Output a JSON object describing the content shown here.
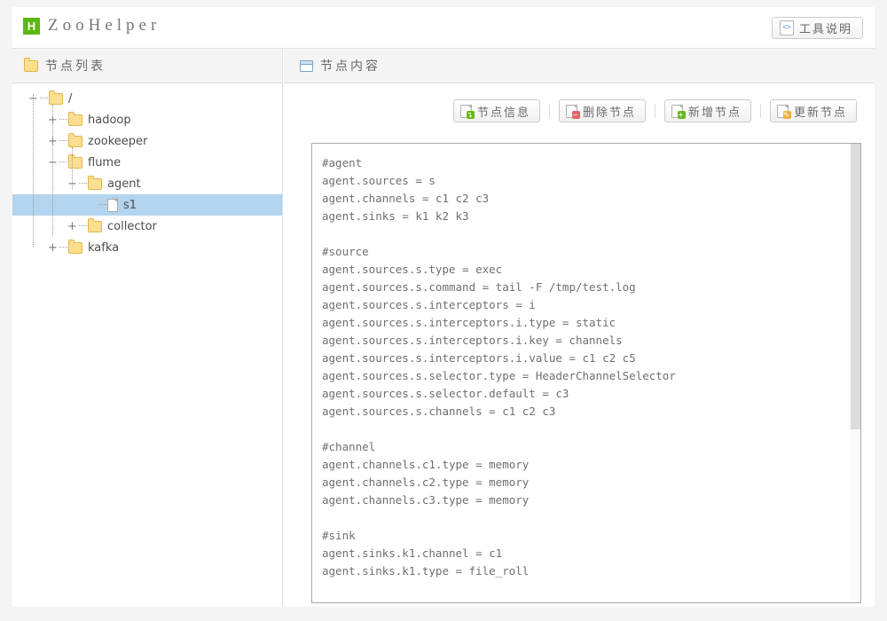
{
  "header": {
    "logo_letter": "H",
    "logo_color": "#5cb811",
    "brand": "ZooHelper",
    "help_button": "工具说明",
    "help_icon": "code-file-icon"
  },
  "left_panel": {
    "title": "节点列表",
    "title_icon": "folder-icon",
    "tree": [
      {
        "label": "/",
        "depth": 0,
        "toggle": "minus",
        "icon": "folder-open-icon",
        "selected": false
      },
      {
        "label": "hadoop",
        "depth": 1,
        "toggle": "plus",
        "icon": "folder-icon",
        "selected": false
      },
      {
        "label": "zookeeper",
        "depth": 1,
        "toggle": "plus",
        "icon": "folder-icon",
        "selected": false
      },
      {
        "label": "flume",
        "depth": 1,
        "toggle": "minus",
        "icon": "folder-open-icon",
        "selected": false
      },
      {
        "label": "agent",
        "depth": 2,
        "toggle": "minus",
        "icon": "folder-open-icon",
        "selected": false
      },
      {
        "label": "s1",
        "depth": 3,
        "toggle": "none",
        "icon": "file-icon",
        "selected": true
      },
      {
        "label": "collector",
        "depth": 2,
        "toggle": "plus",
        "icon": "folder-icon",
        "selected": false
      },
      {
        "label": "kafka",
        "depth": 1,
        "toggle": "plus",
        "icon": "folder-icon",
        "selected": false
      }
    ]
  },
  "right_panel": {
    "title": "节点内容",
    "title_icon": "window-icon",
    "toolbar": [
      {
        "label": "节点信息",
        "icon": "doc-info-icon",
        "badge": "green",
        "badge_glyph": "↴"
      },
      {
        "label": "删除节点",
        "icon": "doc-delete-icon",
        "badge": "red",
        "badge_glyph": "−"
      },
      {
        "label": "新增节点",
        "icon": "doc-add-icon",
        "badge": "green",
        "badge_glyph": "+"
      },
      {
        "label": "更新节点",
        "icon": "doc-edit-icon",
        "badge": "pencil",
        "badge_glyph": "✎"
      }
    ],
    "node_content": "#agent\nagent.sources = s\nagent.channels = c1 c2 c3\nagent.sinks = k1 k2 k3\n\n#source\nagent.sources.s.type = exec\nagent.sources.s.command = tail -F /tmp/test.log\nagent.sources.s.interceptors = i\nagent.sources.s.interceptors.i.type = static\nagent.sources.s.interceptors.i.key = channels\nagent.sources.s.interceptors.i.value = c1 c2 c5\nagent.sources.s.selector.type = HeaderChannelSelector\nagent.sources.s.selector.default = c3\nagent.sources.s.channels = c1 c2 c3\n\n#channel\nagent.channels.c1.type = memory\nagent.channels.c2.type = memory\nagent.channels.c3.type = memory\n\n#sink\nagent.sinks.k1.channel = c1\nagent.sinks.k1.type = file_roll"
  }
}
